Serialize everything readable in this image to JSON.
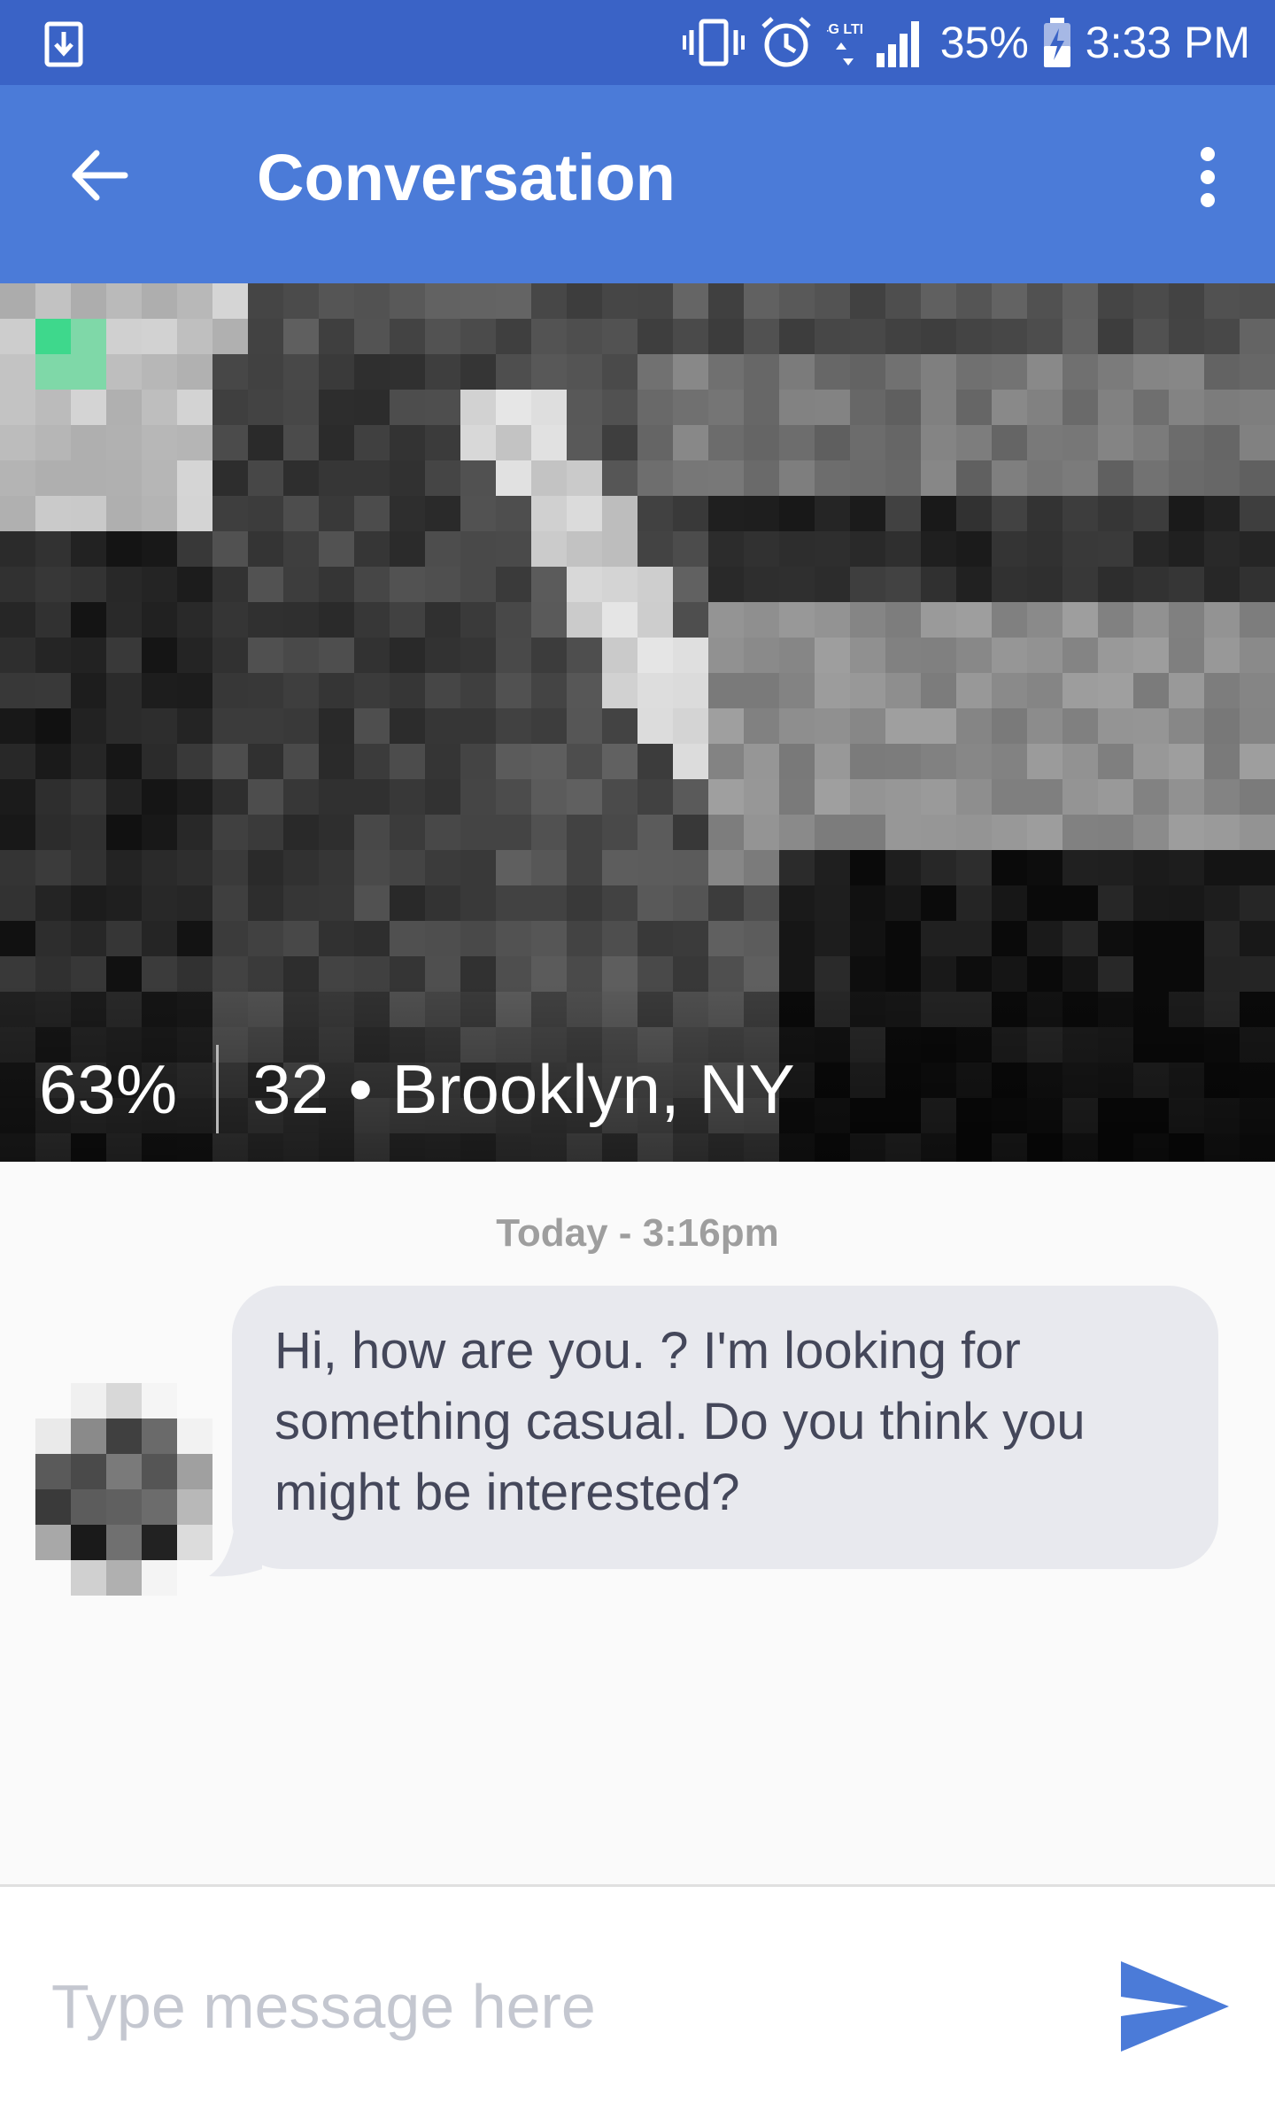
{
  "status_bar": {
    "download_icon": "download-icon",
    "vibrate_icon": "vibrate-icon",
    "alarm_icon": "alarm-icon",
    "network_label": "4G LTE",
    "signal_icon": "signal-icon",
    "battery_percent": "35%",
    "battery_icon": "battery-charging-icon",
    "time": "3:33 PM",
    "background_color": "#3a63c6"
  },
  "app_bar": {
    "title": "Conversation",
    "back_icon": "arrow-back-icon",
    "overflow_icon": "more-vert-icon",
    "background_color": "#4b7bd8"
  },
  "profile": {
    "match_percent": "63%",
    "age_location": "32 • Brooklyn, NY"
  },
  "conversation": {
    "timestamp": "Today - 3:16pm",
    "messages": [
      {
        "text": "Hi, how are you. ? I'm looking for something casual. Do you think you might be interested?",
        "direction": "incoming"
      }
    ]
  },
  "composer": {
    "placeholder": "Type message here",
    "value": "",
    "send_icon": "send-icon",
    "accent_color": "#4b7bd8"
  }
}
